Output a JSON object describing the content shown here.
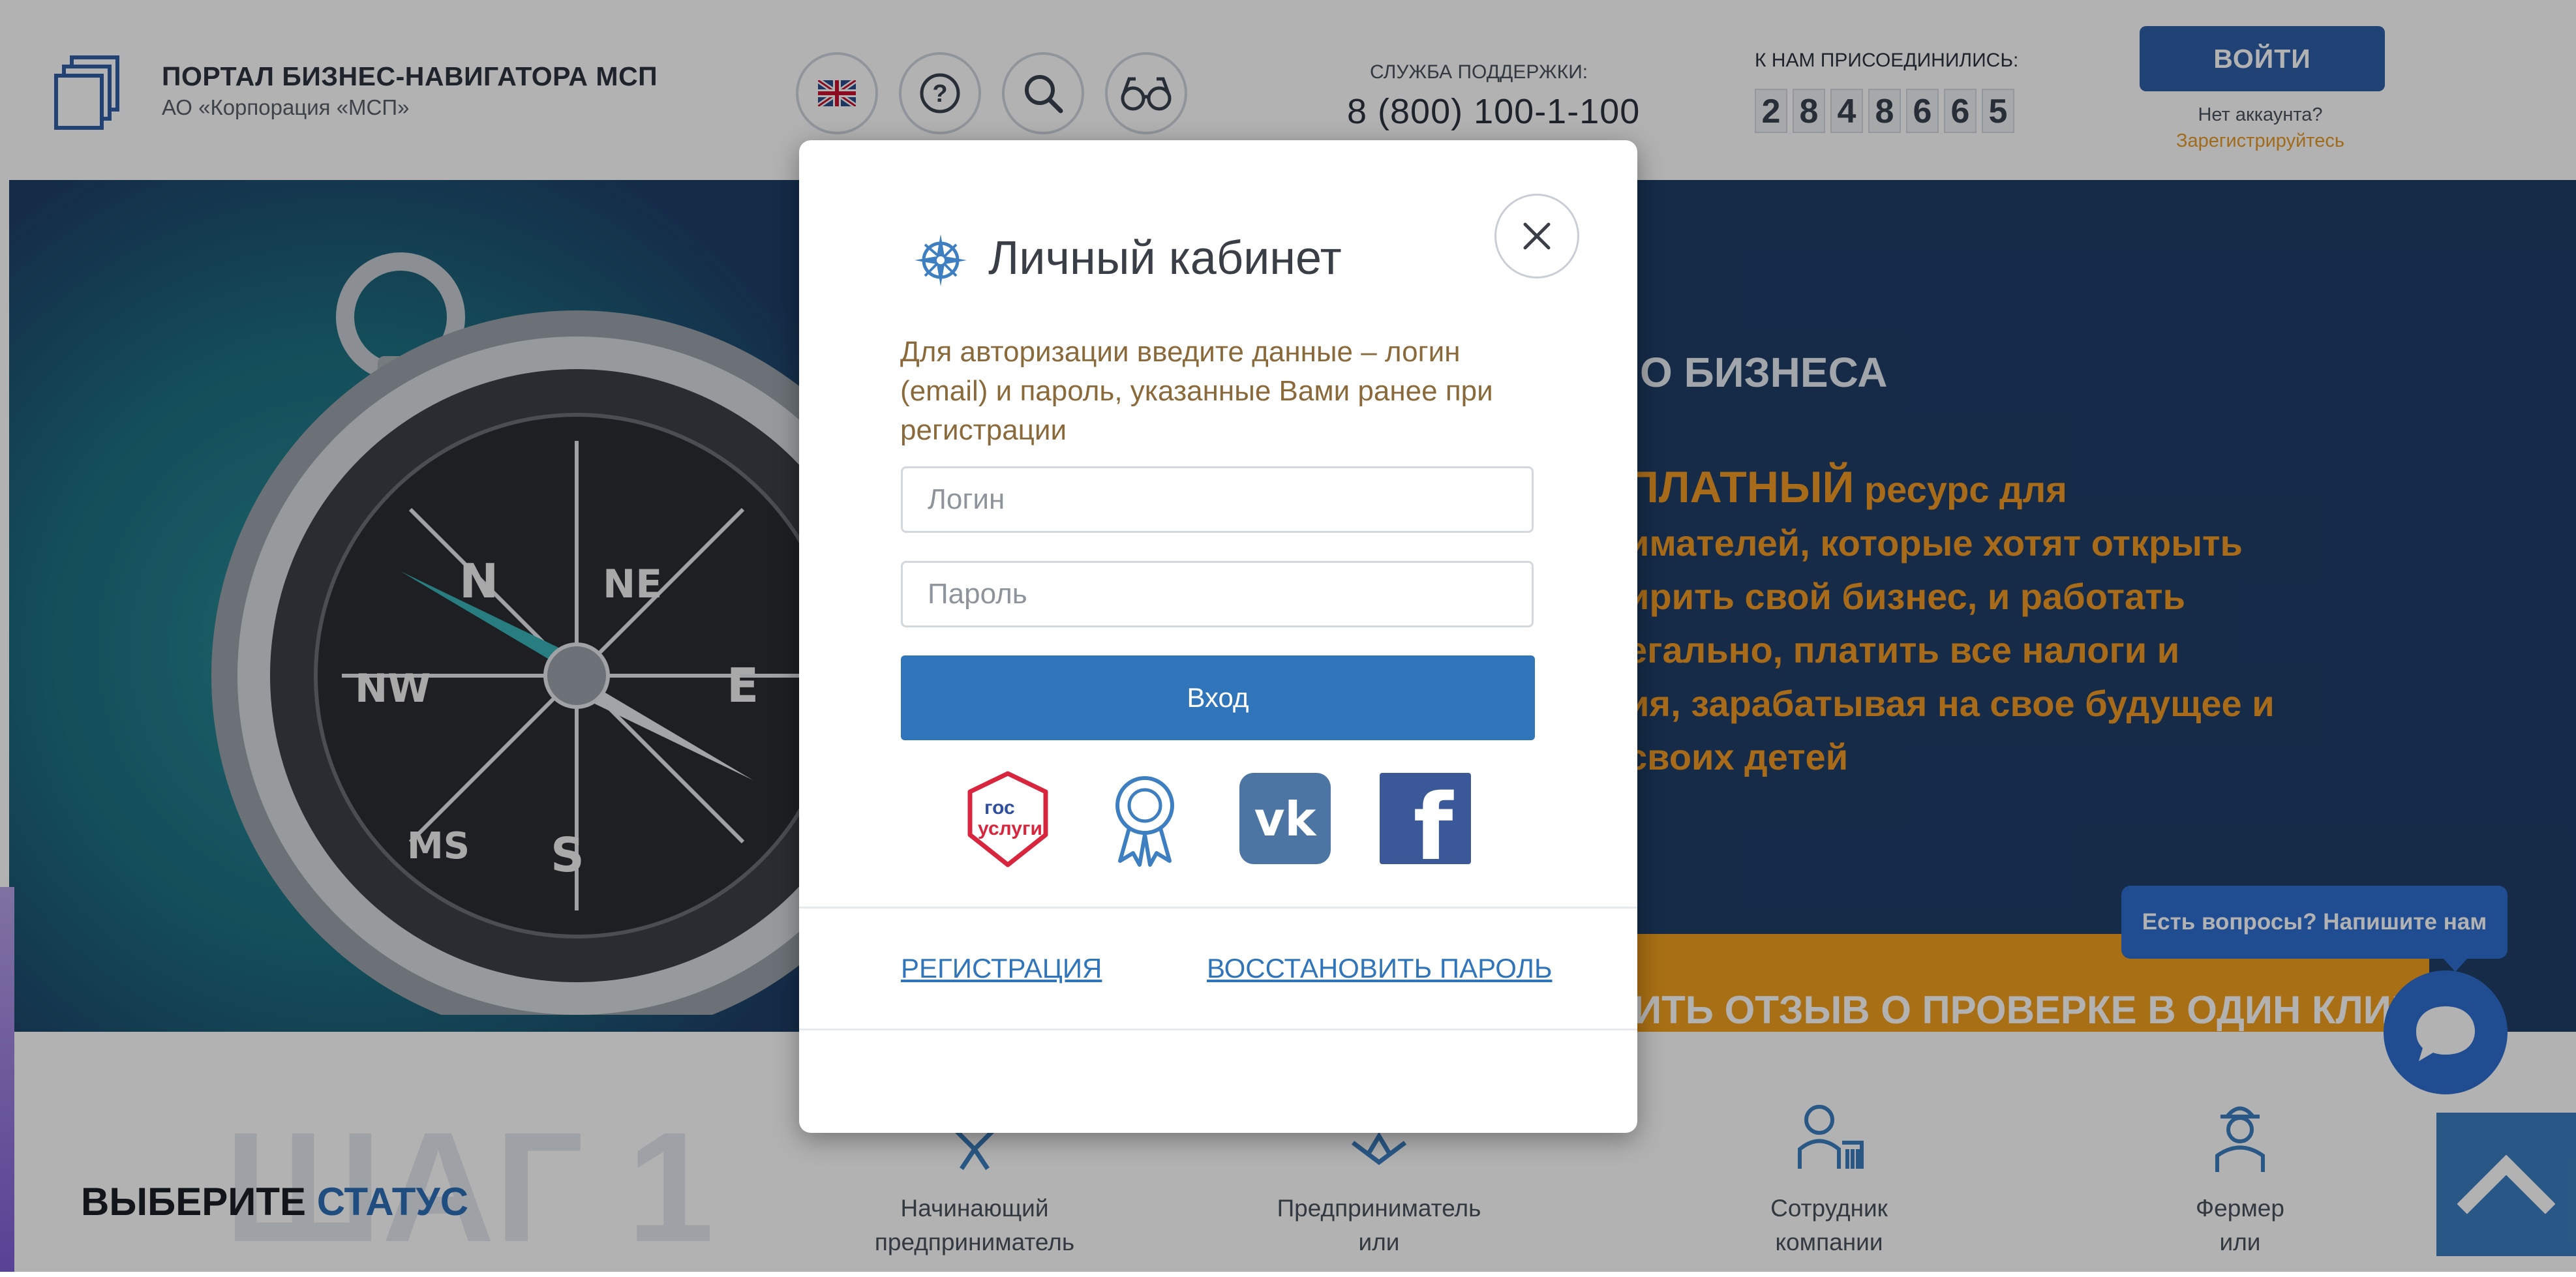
{
  "header": {
    "brand_title": "ПОРТАЛ БИЗНЕС-НАВИГАТОРА МСП",
    "brand_subtitle": "АО «Корпорация «МСП»",
    "support_label": "СЛУЖБА ПОДДЕРЖКИ:",
    "support_phone": "8 (800) 100-1-100",
    "joined_label": "К НАМ ПРИСОЕДИНИЛИСЬ:",
    "joined_digits": [
      "2",
      "8",
      "4",
      "8",
      "6",
      "6",
      "5"
    ],
    "login_label": "ВОЙТИ",
    "no_account": "Нет аккаунта?",
    "register_link": "Зарегистрируйтесь",
    "icons": [
      "uk-flag-icon",
      "help-icon",
      "search-icon",
      "glasses-icon"
    ]
  },
  "hero": {
    "heading_fragment": "О БИЗНЕСА",
    "lines": [
      {
        "lead": "ПЛАТНЫЙ",
        "rest": " ресурс для"
      },
      {
        "lead": "",
        "rest": "имателей, которые хотят открыть"
      },
      {
        "lead": "",
        "rest": "ирить свой бизнес, и работать"
      },
      {
        "lead": "",
        "rest": "егально, платить все налоги и"
      },
      {
        "lead": "",
        "rest": "ия, зарабатывая на свое будущее и"
      },
      {
        "lead": "",
        "rest": "своих детей"
      }
    ],
    "banner_text": "ИТЬ ОТЗЫВ О ПРОВЕРКЕ В ОДИН КЛИК"
  },
  "steps": {
    "ghost": "ШАГ 1",
    "choose_prefix": "ВЫБЕРИТЕ ",
    "choose_accent": "СТАТУС",
    "items": [
      {
        "label1": "Начинающий",
        "label2": "предприниматель",
        "icon": "beginner-icon"
      },
      {
        "label1": "Предприниматель",
        "label2": "или",
        "icon": "entrepreneur-icon"
      },
      {
        "label1": "Сотрудник",
        "label2": "компании",
        "icon": "employee-icon"
      },
      {
        "label1": "Фермер",
        "label2": "или",
        "icon": "farmer-icon"
      }
    ]
  },
  "chat": {
    "bubble_text": "Есть вопросы? Напишите нам"
  },
  "modal": {
    "title": "Личный кабинет",
    "description": "Для авторизации введите данные – логин (email) и пароль, указанные Вами ранее при регистрации",
    "login_placeholder": "Логин",
    "password_placeholder": "Пароль",
    "submit_label": "Вход",
    "gosuslugi_top": "гос",
    "gosuslugi_bottom": "услуги",
    "vk_label": "vk",
    "fb_label": "f",
    "register_label": "РЕГИСТРАЦИЯ",
    "restore_label": "ВОССТАНОВИТЬ ПАРОЛЬ"
  },
  "colors": {
    "brand_blue": "#2f5fa7",
    "accent_orange": "#f1a01e",
    "hero_bg": "#1f3e68",
    "link_blue": "#3075b9"
  }
}
